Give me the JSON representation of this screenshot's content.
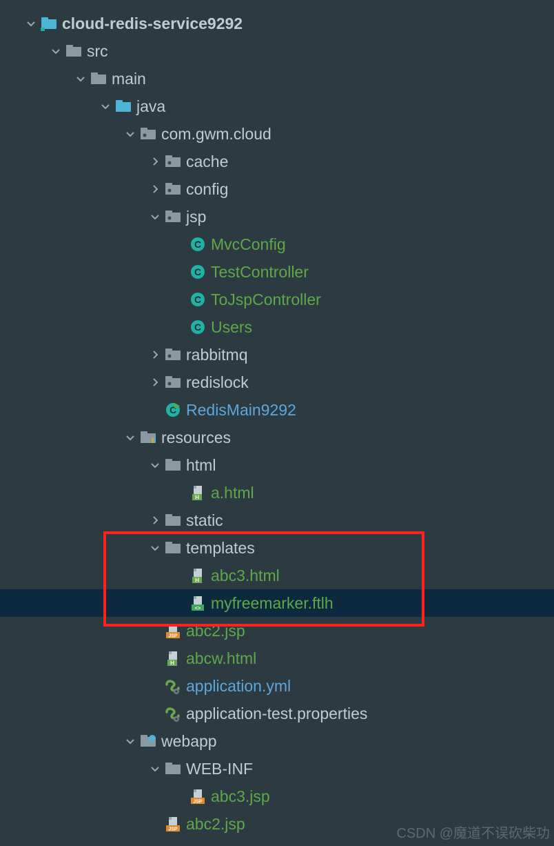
{
  "colors": {
    "bg": "#2b3b41",
    "text": "#c0cccf",
    "new": "#5fa84a",
    "selected": "#0d293e",
    "highlight": "#ff2020",
    "folderBlue": "#4fb5d6",
    "folderGrey": "#8a9aa3",
    "classCircle": "#1fb3a6",
    "htmlIcon": "#6aa84f",
    "jspIcon": "#e08b2c",
    "ftlIcon": "#3fa75f",
    "ymlIcon": "#6aa84f"
  },
  "watermark": "CSDN @魔道不误砍柴功",
  "tree": [
    {
      "d": 0,
      "exp": "open",
      "icon": "module",
      "label": "cloud-redis-service9292",
      "cls": "bold"
    },
    {
      "d": 1,
      "exp": "open",
      "icon": "folder-grey",
      "label": "src"
    },
    {
      "d": 2,
      "exp": "open",
      "icon": "folder-grey",
      "label": "main"
    },
    {
      "d": 3,
      "exp": "open",
      "icon": "folder-blue",
      "label": "java"
    },
    {
      "d": 4,
      "exp": "open",
      "icon": "pkg",
      "label": "com.gwm.cloud"
    },
    {
      "d": 5,
      "exp": "closed",
      "icon": "pkg",
      "label": "cache"
    },
    {
      "d": 5,
      "exp": "closed",
      "icon": "pkg",
      "label": "config"
    },
    {
      "d": 5,
      "exp": "open",
      "icon": "pkg",
      "label": "jsp"
    },
    {
      "d": 6,
      "exp": "none",
      "icon": "class",
      "label": "MvcConfig",
      "cls": "new"
    },
    {
      "d": 6,
      "exp": "none",
      "icon": "class",
      "label": "TestController",
      "cls": "new"
    },
    {
      "d": 6,
      "exp": "none",
      "icon": "class",
      "label": "ToJspController",
      "cls": "new"
    },
    {
      "d": 6,
      "exp": "none",
      "icon": "class",
      "label": "Users",
      "cls": "new"
    },
    {
      "d": 5,
      "exp": "closed",
      "icon": "pkg",
      "label": "rabbitmq"
    },
    {
      "d": 5,
      "exp": "closed",
      "icon": "pkg",
      "label": "redislock"
    },
    {
      "d": 5,
      "exp": "none",
      "icon": "run-class",
      "label": "RedisMain9292",
      "cls": "runapp2"
    },
    {
      "d": 4,
      "exp": "open",
      "icon": "resources",
      "label": "resources"
    },
    {
      "d": 5,
      "exp": "open",
      "icon": "folder-grey",
      "label": "html"
    },
    {
      "d": 6,
      "exp": "none",
      "icon": "html",
      "label": "a.html",
      "cls": "new"
    },
    {
      "d": 5,
      "exp": "closed",
      "icon": "folder-grey",
      "label": "static"
    },
    {
      "d": 5,
      "exp": "open",
      "icon": "folder-grey",
      "label": "templates"
    },
    {
      "d": 6,
      "exp": "none",
      "icon": "html",
      "label": "abc3.html",
      "cls": "new"
    },
    {
      "d": 6,
      "exp": "none",
      "icon": "ftl",
      "label": "myfreemarker.ftlh",
      "cls": "new",
      "selected": true
    },
    {
      "d": 5,
      "exp": "none",
      "icon": "jsp",
      "label": "abc2.jsp",
      "cls": "new"
    },
    {
      "d": 5,
      "exp": "none",
      "icon": "html",
      "label": "abcw.html",
      "cls": "new"
    },
    {
      "d": 5,
      "exp": "none",
      "icon": "yml",
      "label": "application.yml",
      "cls": "runapp2"
    },
    {
      "d": 5,
      "exp": "none",
      "icon": "yml",
      "label": "application-test.properties"
    },
    {
      "d": 4,
      "exp": "open",
      "icon": "webapp",
      "label": "webapp"
    },
    {
      "d": 5,
      "exp": "open",
      "icon": "folder-grey",
      "label": "WEB-INF"
    },
    {
      "d": 6,
      "exp": "none",
      "icon": "jsp",
      "label": "abc3.jsp",
      "cls": "new"
    },
    {
      "d": 5,
      "exp": "none",
      "icon": "jsp",
      "label": "abc2.jsp",
      "cls": "new"
    }
  ]
}
